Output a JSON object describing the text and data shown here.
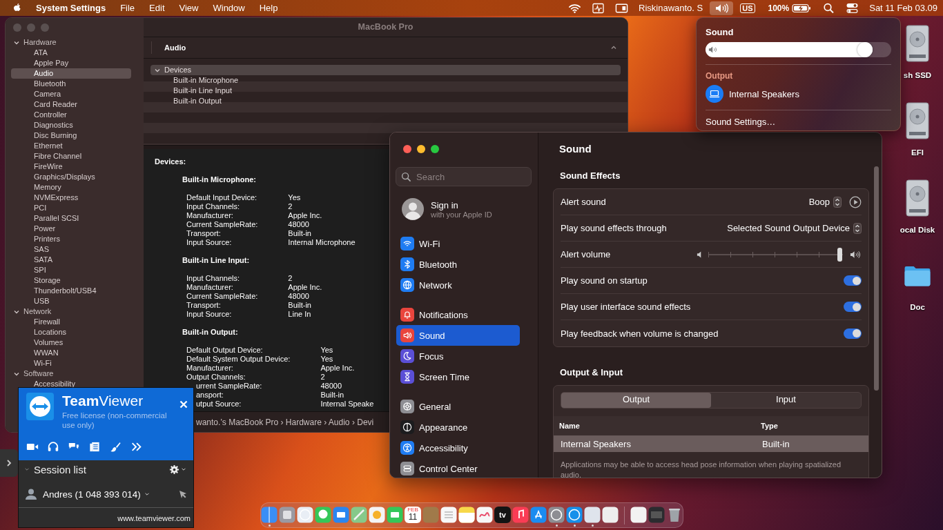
{
  "menu_bar": {
    "app": "System Settings",
    "menus": [
      "File",
      "Edit",
      "View",
      "Window",
      "Help"
    ],
    "user": "Riskinawanto. S",
    "volume_open": true,
    "input_source": "US",
    "battery": "100%",
    "clock": "Sat 11 Feb  03.09"
  },
  "system_information": {
    "title": "MacBook Pro",
    "sidebar": [
      {
        "label": "Hardware",
        "expanded": true,
        "children": [
          {
            "label": "ATA",
            "selected": false
          },
          {
            "label": "Apple Pay",
            "selected": false
          },
          {
            "label": "Audio",
            "selected": true
          },
          {
            "label": "Bluetooth",
            "selected": false
          },
          {
            "label": "Camera",
            "selected": false
          },
          {
            "label": "Card Reader",
            "selected": false
          },
          {
            "label": "Controller",
            "selected": false
          },
          {
            "label": "Diagnostics",
            "selected": false
          },
          {
            "label": "Disc Burning",
            "selected": false
          },
          {
            "label": "Ethernet",
            "selected": false
          },
          {
            "label": "Fibre Channel",
            "selected": false
          },
          {
            "label": "FireWire",
            "selected": false
          },
          {
            "label": "Graphics/Displays",
            "selected": false
          },
          {
            "label": "Memory",
            "selected": false
          },
          {
            "label": "NVMExpress",
            "selected": false
          },
          {
            "label": "PCI",
            "selected": false
          },
          {
            "label": "Parallel SCSI",
            "selected": false
          },
          {
            "label": "Power",
            "selected": false
          },
          {
            "label": "Printers",
            "selected": false
          },
          {
            "label": "SAS",
            "selected": false
          },
          {
            "label": "SATA",
            "selected": false
          },
          {
            "label": "SPI",
            "selected": false
          },
          {
            "label": "Storage",
            "selected": false
          },
          {
            "label": "Thunderbolt/USB4",
            "selected": false
          },
          {
            "label": "USB",
            "selected": false
          }
        ]
      },
      {
        "label": "Network",
        "expanded": true,
        "children": [
          {
            "label": "Firewall",
            "selected": false
          },
          {
            "label": "Locations",
            "selected": false
          },
          {
            "label": "Volumes",
            "selected": false
          },
          {
            "label": "WWAN",
            "selected": false
          },
          {
            "label": "Wi-Fi",
            "selected": false
          }
        ]
      },
      {
        "label": "Software",
        "expanded": true,
        "children": [
          {
            "label": "Accessibility",
            "selected": false
          }
        ]
      }
    ],
    "pane_title": "Audio",
    "tree": [
      {
        "label": "Devices",
        "expanded": true,
        "selected": true,
        "children": [
          {
            "label": "Built-in Microphone",
            "selected": false
          },
          {
            "label": "Built-in Line Input",
            "selected": false
          },
          {
            "label": "Built-in Output",
            "selected": false
          }
        ]
      }
    ],
    "details_title": "Devices:",
    "devices": [
      {
        "name": "Built-in Microphone:",
        "rows": [
          {
            "label": "Default Input Device:",
            "value": "Yes"
          },
          {
            "label": "Input Channels:",
            "value": "2"
          },
          {
            "label": "Manufacturer:",
            "value": "Apple Inc."
          },
          {
            "label": "Current SampleRate:",
            "value": "48000"
          },
          {
            "label": "Transport:",
            "value": "Built-in"
          },
          {
            "label": "Input Source:",
            "value": "Internal Microphone"
          }
        ]
      },
      {
        "name": "Built-in Line Input:",
        "rows": [
          {
            "label": "Input Channels:",
            "value": "2"
          },
          {
            "label": "Manufacturer:",
            "value": "Apple Inc."
          },
          {
            "label": "Current SampleRate:",
            "value": "48000"
          },
          {
            "label": "Transport:",
            "value": "Built-in"
          },
          {
            "label": "Input Source:",
            "value": "Line In"
          }
        ]
      },
      {
        "name": "Built-in Output:",
        "rows": [
          {
            "label": "Default Output Device:",
            "value": "Yes"
          },
          {
            "label": "Default System Output Device:",
            "value": "Yes"
          },
          {
            "label": "Manufacturer:",
            "value": "Apple Inc."
          },
          {
            "label": "Output Channels:",
            "value": "2"
          },
          {
            "label": "urrent SampleRate:",
            "value": "48000",
            "cut": true
          },
          {
            "label": "ansport:",
            "value": "Built-in",
            "cut": true
          },
          {
            "label": "utput Source:",
            "value": "Internal Speake",
            "cut": true
          }
        ]
      }
    ],
    "breadcrumb": "wanto.’s MacBook Pro › Hardware › Audio › Devi"
  },
  "sound_settings": {
    "search": {
      "placeholder": "Search"
    },
    "account": {
      "title": "Sign in",
      "subtitle": "with your Apple ID"
    },
    "sidebar_groups": [
      {
        "items": [
          {
            "label": "Wi-Fi",
            "kind": "wifi",
            "color": "#1f7cf2",
            "selected": false
          },
          {
            "label": "Bluetooth",
            "kind": "bluetooth",
            "color": "#1f7cf2",
            "selected": false
          },
          {
            "label": "Network",
            "kind": "network",
            "color": "#1f7cf2",
            "selected": false
          }
        ]
      },
      {
        "items": [
          {
            "label": "Notifications",
            "kind": "notifications",
            "color": "#e9453d",
            "selected": false
          },
          {
            "label": "Sound",
            "kind": "sound",
            "color": "#e9453d",
            "selected": true
          },
          {
            "label": "Focus",
            "kind": "focus",
            "color": "#5b4fd6",
            "selected": false
          },
          {
            "label": "Screen Time",
            "kind": "screen-time",
            "color": "#5b4fd6",
            "selected": false
          }
        ]
      },
      {
        "items": [
          {
            "label": "General",
            "kind": "general",
            "color": "#8e8e93",
            "selected": false
          },
          {
            "label": "Appearance",
            "kind": "appearance",
            "color": "#1c1c1e",
            "selected": false
          },
          {
            "label": "Accessibility",
            "kind": "accessibility",
            "color": "#1f7cf2",
            "selected": false
          },
          {
            "label": "Control Center",
            "kind": "control-center",
            "color": "#8e8e93",
            "selected": false
          }
        ]
      }
    ],
    "title": "Sound",
    "effects_heading": "Sound Effects",
    "effects": [
      {
        "kind": "select",
        "label": "Alert sound",
        "value": "Boop",
        "play_button": true
      },
      {
        "kind": "select",
        "label": "Play sound effects through",
        "value": "Selected Sound Output Device",
        "play_button": false
      },
      {
        "kind": "slider",
        "label": "Alert volume",
        "level": 0.98
      },
      {
        "kind": "toggle",
        "label": "Play sound on startup",
        "on": true
      },
      {
        "kind": "toggle",
        "label": "Play user interface sound effects",
        "on": true
      },
      {
        "kind": "toggle",
        "label": "Play feedback when volume is changed",
        "on": true
      }
    ],
    "io_heading": "Output & Input",
    "segments": [
      {
        "label": "Output",
        "selected": true
      },
      {
        "label": "Input",
        "selected": false
      }
    ],
    "table": {
      "columns": [
        "Name",
        "Type"
      ],
      "rows": [
        {
          "cells": [
            "Internal Speakers",
            "Built-in"
          ],
          "selected": true
        }
      ]
    },
    "note": "Applications may be able to access head pose information when playing spatialized audio."
  },
  "sound_menu": {
    "title": "Sound",
    "level": 0.9,
    "section": "Output",
    "devices": [
      {
        "label": "Internal Speakers",
        "selected": true
      }
    ],
    "action": "Sound Settings…"
  },
  "teamviewer": {
    "title": "**Team**Viewer",
    "license": "Free license (non-commercial use only)",
    "session_heading": "Session list",
    "sessions": [
      {
        "label": "Andres (1 048 393 014)"
      }
    ],
    "website": "www.teamviewer.com"
  },
  "desktop_icons": [
    {
      "label": "sh SSD",
      "kind": "drive"
    },
    {
      "label": "EFI",
      "kind": "drive"
    },
    {
      "label": "ocal Disk",
      "kind": "drive"
    },
    {
      "label": "Doc",
      "kind": "folder"
    }
  ],
  "dock": [
    {
      "kind": "finder",
      "running": true
    },
    {
      "kind": "launchpad",
      "running": false
    },
    {
      "kind": "safari",
      "running": false
    },
    {
      "kind": "messages",
      "running": false
    },
    {
      "kind": "mail",
      "running": false
    },
    {
      "kind": "maps",
      "running": false
    },
    {
      "kind": "photos",
      "running": false
    },
    {
      "kind": "facetime",
      "running": false
    },
    {
      "kind": "calendar",
      "caption": "FEB",
      "text": "11",
      "running": false
    },
    {
      "kind": "archive",
      "running": false
    },
    {
      "kind": "reminders",
      "running": false
    },
    {
      "kind": "notes",
      "running": false
    },
    {
      "kind": "freeform",
      "running": false
    },
    {
      "kind": "tv",
      "text": "tv",
      "running": false
    },
    {
      "kind": "music",
      "running": false
    },
    {
      "kind": "appstore",
      "running": false
    },
    {
      "kind": "settings",
      "running": true
    },
    {
      "kind": "teamviewer",
      "running": true
    },
    {
      "kind": "blank",
      "running": true
    },
    {
      "kind": "preview",
      "running": false
    },
    {
      "kind": "separator"
    },
    {
      "kind": "file",
      "running": false
    },
    {
      "kind": "screen",
      "running": false
    },
    {
      "kind": "trash",
      "running": false
    }
  ]
}
